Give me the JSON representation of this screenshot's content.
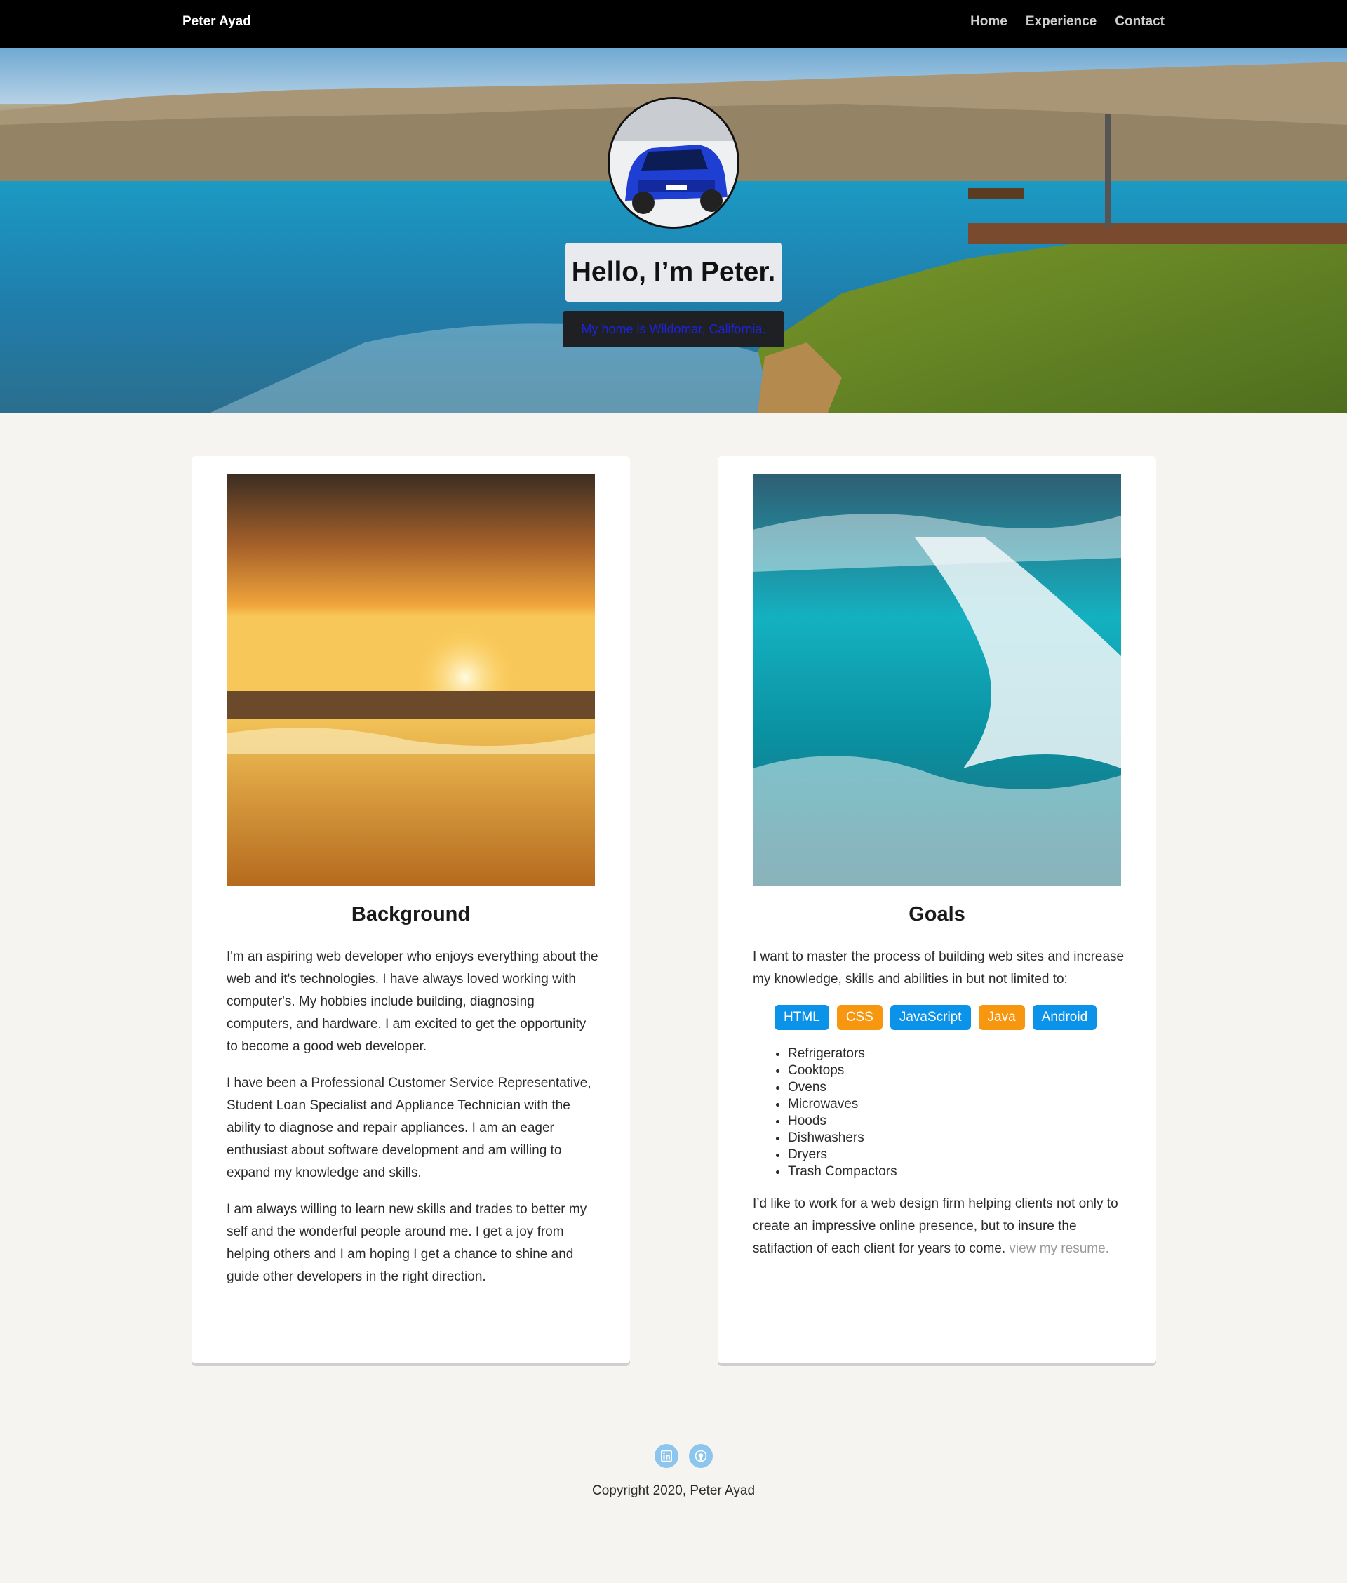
{
  "nav": {
    "brand": "Peter Ayad",
    "links": [
      "Home",
      "Experience",
      "Contact"
    ]
  },
  "hero": {
    "title": "Hello, I’m Peter.",
    "subtitle": "My home is Wildomar, California.",
    "avatar_icon": "car-avatar-icon"
  },
  "background_card": {
    "image": "sunset-beach-image",
    "title": "Background",
    "paragraphs": [
      "I'm an aspiring web developer who enjoys everything about the web and it's technologies. I have always loved working with computer's. My hobbies include building, diagnosing computers, and hardware. I am excited to get the opportunity to become a good web developer.",
      "I have been a Professional Customer Service Representative, Student Loan Specialist and Appliance Technician with the ability to diagnose and repair appliances. I am an eager enthusiast about software development and am willing to expand my knowledge and skills.",
      "I am always willing to learn new skills and trades to better my self and the wonderful people around me. I get a joy from helping others and I am hoping I get a chance to shine and guide other developers in the right direction."
    ]
  },
  "goals_card": {
    "image": "ocean-wave-image",
    "title": "Goals",
    "intro": "I want to master the process of building web sites and increase my knowledge, skills and abilities in but not limited to:",
    "tags": [
      {
        "label": "HTML",
        "color": "#0b93e9"
      },
      {
        "label": "CSS",
        "color": "#f7960f"
      },
      {
        "label": "JavaScript",
        "color": "#0b93e9"
      },
      {
        "label": "Java",
        "color": "#f7960f"
      },
      {
        "label": "Android",
        "color": "#0b93e9"
      }
    ],
    "list": [
      "Refrigerators",
      "Cooktops",
      "Ovens",
      "Microwaves",
      "Hoods",
      "Dishwashers",
      "Dryers",
      "Trash Compactors"
    ],
    "closing": "I’d like to work for a web design firm helping clients not only to create an impressive online presence, but to insure the satifaction of each client for years to come.",
    "resume_link": "view my resume."
  },
  "footer": {
    "social": [
      "linkedin-icon",
      "github-icon"
    ],
    "copyright": "Copyright 2020, Peter Ayad"
  },
  "colors": {
    "nav_bg": "#000000",
    "page_bg": "#f5f4f0",
    "tag_blue": "#0b93e9",
    "tag_orange": "#f7960f",
    "subtitle_text": "#1d23d8"
  }
}
